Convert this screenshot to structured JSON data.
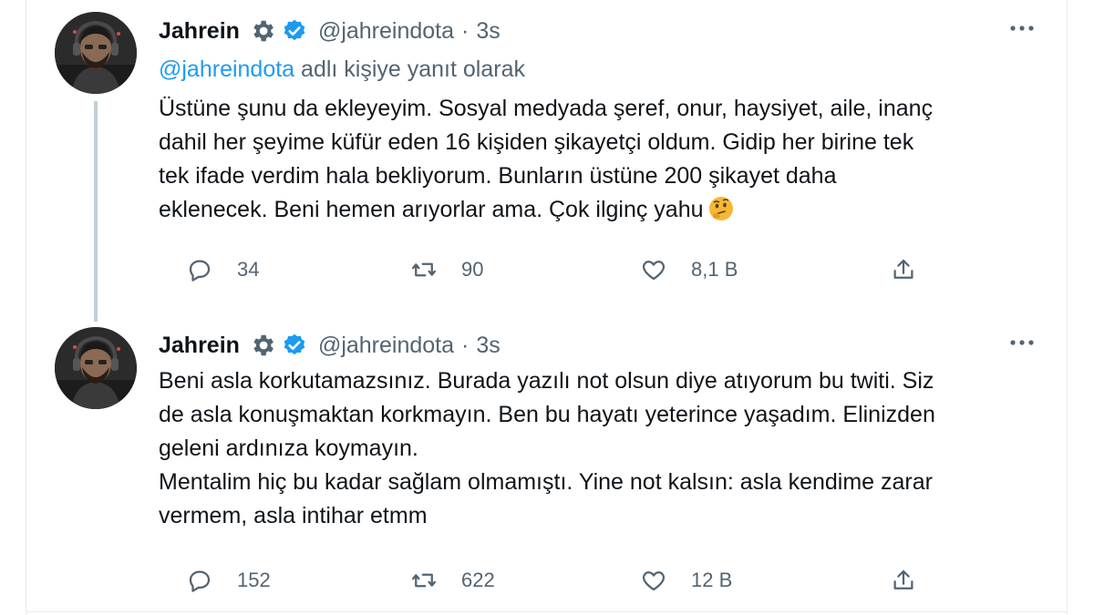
{
  "colors": {
    "text": "#0f1419",
    "secondary": "#536471",
    "link": "#1d9bf0",
    "verified": "#1d9bf0",
    "thread_line": "#c4cfd6"
  },
  "tweets": [
    {
      "author": {
        "name": "Jahrein",
        "handle": "@jahreindota",
        "badge_icon": "gear-icon",
        "verified_icon": "verified-badge-icon"
      },
      "separator": "·",
      "time": "3s",
      "reply_prefix": "@jahreindota",
      "reply_suffix": " adlı kişiye yanıt olarak",
      "text": "Üstüne şunu da ekleyeyim. Sosyal medyada şeref, onur, haysiyet, aile, inanç\ndahil her şeyime küfür eden 16 kişiden şikayetçi oldum. Gidip her birine tek\ntek ifade verdim hala bekliyorum. Bunların üstüne 200 şikayet daha\neklenecek. Beni hemen arıyorlar ama. Çok ilginç yahu",
      "emoji": "thinking-face-emoji",
      "stats": {
        "replies": "34",
        "retweets": "90",
        "likes": "8,1 B"
      }
    },
    {
      "author": {
        "name": "Jahrein",
        "handle": "@jahreindota",
        "badge_icon": "gear-icon",
        "verified_icon": "verified-badge-icon"
      },
      "separator": "·",
      "time": "3s",
      "text": "Beni asla korkutamazsınız. Burada yazılı not olsun diye atıyorum bu twiti. Siz\nde asla konuşmaktan korkmayın. Ben bu hayatı yeterince yaşadım. Elinizden\ngeleni ardınıza koymayın.\nMentalim hiç bu kadar sağlam olmamıştı. Yine not kalsın: asla kendime zarar\nvermem, asla intihar etmm",
      "stats": {
        "replies": "152",
        "retweets": "622",
        "likes": "12 B"
      }
    }
  ]
}
